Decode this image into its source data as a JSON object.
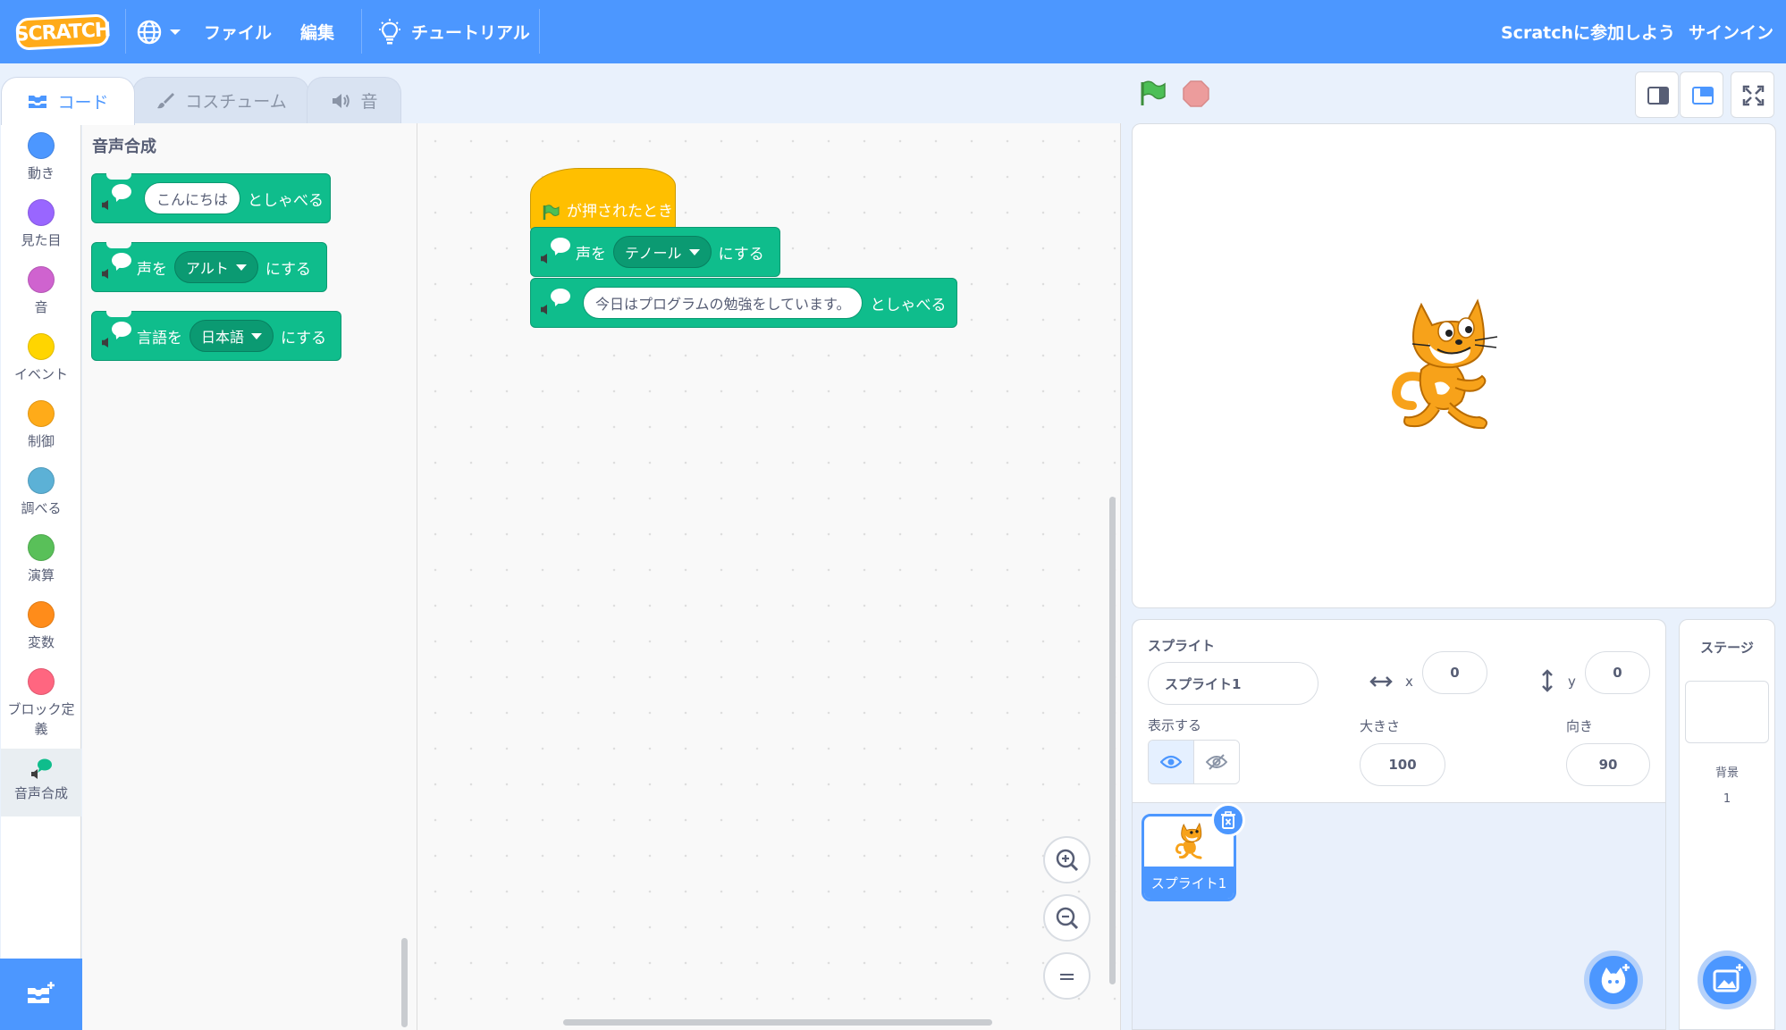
{
  "menubar": {
    "logo_text": "SCRATCH",
    "file": "ファイル",
    "edit": "編集",
    "tutorial": "チュートリアル",
    "join": "Scratchに参加しよう",
    "signin": "サインイン"
  },
  "tabs": [
    {
      "label": "コード"
    },
    {
      "label": "コスチューム"
    },
    {
      "label": "音"
    }
  ],
  "categories": [
    {
      "label": "動き",
      "color": "#4c97ff"
    },
    {
      "label": "見た目",
      "color": "#9966ff"
    },
    {
      "label": "音",
      "color": "#cf63cf"
    },
    {
      "label": "イベント",
      "color": "#ffd500"
    },
    {
      "label": "制御",
      "color": "#ffab19"
    },
    {
      "label": "調べる",
      "color": "#5cb1d6"
    },
    {
      "label": "演算",
      "color": "#59c059"
    },
    {
      "label": "変数",
      "color": "#ff8c1a"
    },
    {
      "label": "ブロック定義",
      "color": "#ff6680"
    },
    {
      "label": "音声合成",
      "color": "#0fbd8c"
    }
  ],
  "palette": {
    "title": "音声合成",
    "speak_prefix": "",
    "speak_input": "こんにちは",
    "speak_suffix": "としゃべる",
    "voice_prefix": "声を",
    "voice_value": "アルト",
    "voice_suffix": "にする",
    "lang_prefix": "言語を",
    "lang_value": "日本語",
    "lang_suffix": "にする"
  },
  "script": {
    "hat_label": "が押されたとき",
    "voice_prefix": "声を",
    "voice_value": "テノール",
    "voice_suffix": "にする",
    "speak_input": "今日はプログラムの勉強をしています。",
    "speak_suffix": "としゃべる"
  },
  "zoom": {
    "in": "+",
    "out": "−",
    "reset": "="
  },
  "sprite_info": {
    "sprite_label": "スプライト",
    "sprite_name": "スプライト1",
    "x_label": "x",
    "x_value": "0",
    "y_label": "y",
    "y_value": "0",
    "show_label": "表示する",
    "size_label": "大きさ",
    "size_value": "100",
    "direction_label": "向き",
    "direction_value": "90"
  },
  "sprite_list": [
    {
      "name": "スプライト1",
      "selected": true
    }
  ],
  "stage_panel": {
    "title": "ステージ",
    "backdrop_label": "背景",
    "backdrop_count": "1"
  },
  "colors": {
    "menubar": "#4c97ff",
    "pen_green": "#0fbd8c",
    "events_yellow": "#ffbf00",
    "stop_red": "#ec9c9c",
    "flag_green": "#4cbf56"
  }
}
